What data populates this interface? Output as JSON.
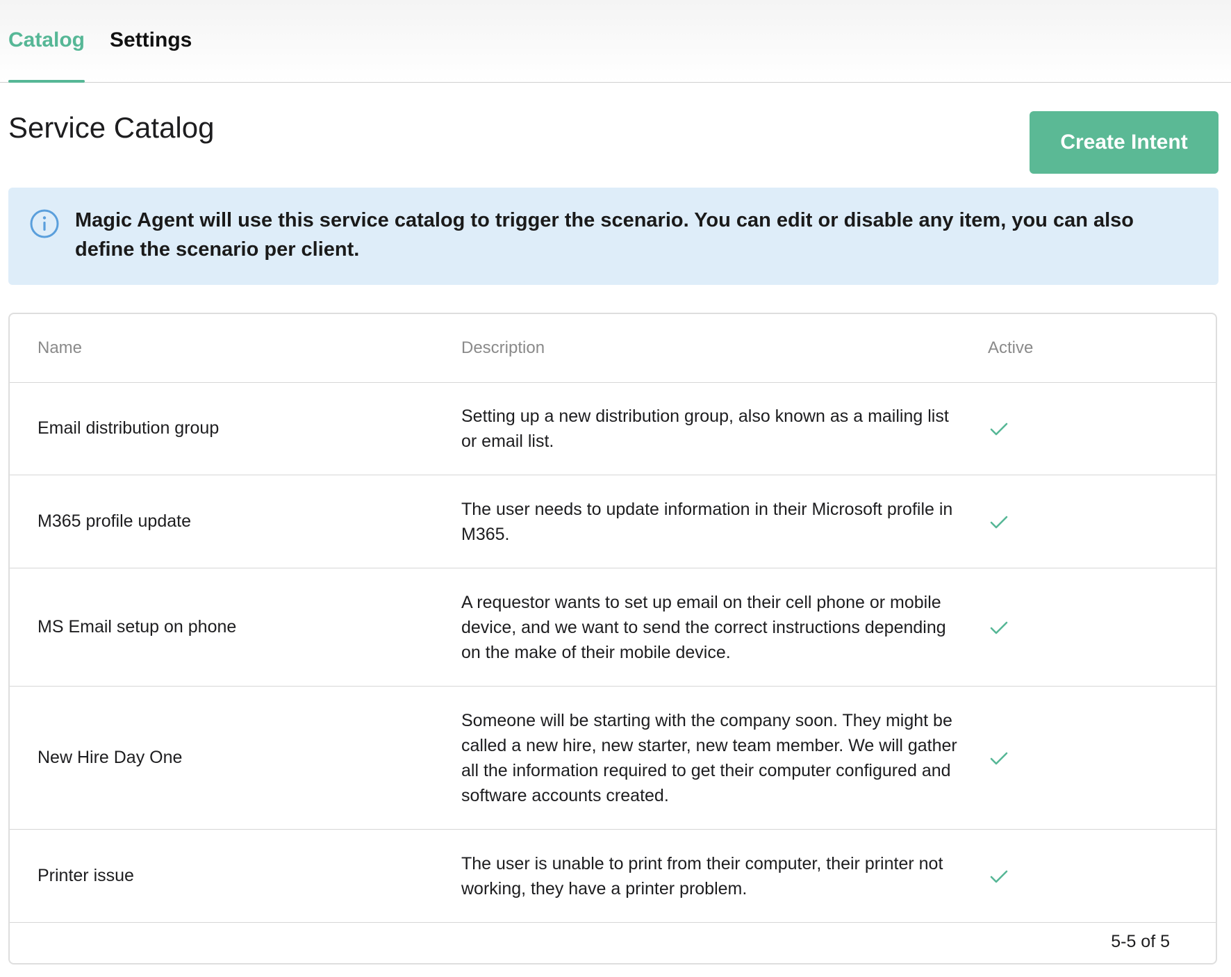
{
  "tabs": [
    {
      "label": "Catalog",
      "active": true
    },
    {
      "label": "Settings",
      "active": false
    }
  ],
  "page": {
    "title": "Service Catalog",
    "create_button_label": "Create Intent"
  },
  "banner": {
    "icon": "info-icon",
    "text": "Magic Agent will use this service catalog to trigger the scenario. You can edit or disable any item, you can also define the scenario per client."
  },
  "table": {
    "columns": [
      "Name",
      "Description",
      "Active"
    ],
    "rows": [
      {
        "name": "Email distribution group",
        "description": "Setting up a new distribution group, also known as a mailing list or email list.",
        "active": true
      },
      {
        "name": "M365 profile update",
        "description": "The user needs to update information in their Microsoft profile in M365.",
        "active": true
      },
      {
        "name": "MS Email setup on phone",
        "description": "A requestor wants to set up email on their cell phone or mobile device, and we want to send the correct instructions depending on the make of their mobile device.",
        "active": true
      },
      {
        "name": "New Hire Day One",
        "description": "Someone will be starting with the company soon. They might be called a new hire, new starter, new team member. We will gather all the information required to get their computer configured and software accounts created.",
        "active": true
      },
      {
        "name": "Printer issue",
        "description": "The user is unable to print from their computer, their printer not working, they have a printer problem.",
        "active": true
      }
    ],
    "pagination": "5-5 of 5"
  },
  "colors": {
    "accent": "#56b796",
    "banner_bg": "#deedf9",
    "info_icon": "#5a9fdc"
  }
}
